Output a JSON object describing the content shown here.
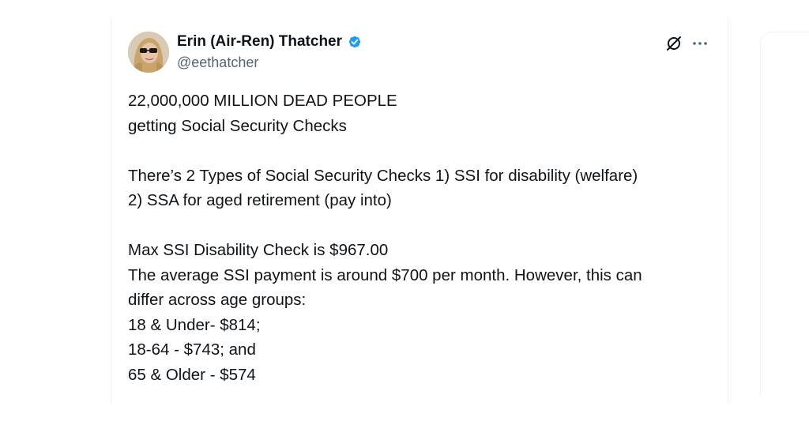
{
  "tweet": {
    "author": {
      "display_name": "Erin (Air-Ren) Thatcher",
      "handle": "@eethatcher",
      "verified": true,
      "avatar_icon": "profile-photo"
    },
    "actions": {
      "grok_icon": "grok-icon",
      "more_icon": "more-options-icon"
    },
    "paragraphs": [
      [
        "22,000,000 MILLION DEAD PEOPLE",
        "getting Social Security Checks"
      ],
      [
        "There’s 2 Types of Social Security Checks 1) SSI for disability (welfare)",
        "2) SSA for aged retirement (pay into)"
      ],
      [
        "Max SSI Disability Check is $967.00",
        "The average SSI payment is around $700 per month. However, this can",
        "differ across age groups:",
        "18 & Under- $814;",
        "18-64 - $743; and",
        "65 & Older - $574"
      ]
    ]
  },
  "colors": {
    "text": "#0f1419",
    "secondary_text": "#536471",
    "verified_badge": "#1d9bf0",
    "border": "#eff3f4"
  }
}
